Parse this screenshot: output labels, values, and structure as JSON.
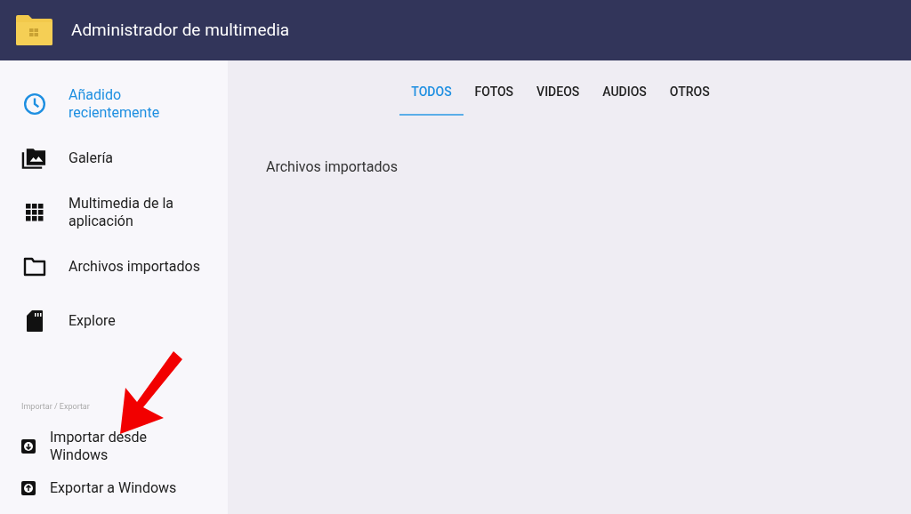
{
  "window": {
    "title": "Administrador de multimedia"
  },
  "sidebar": {
    "items": [
      {
        "label": "Añadido recientemente",
        "kind": "clock",
        "selected": true
      },
      {
        "label": "Galería",
        "kind": "gallery",
        "selected": false
      },
      {
        "label": "Multimedia de la aplicación",
        "kind": "grid",
        "selected": false
      },
      {
        "label": "Archivos importados",
        "kind": "folder",
        "selected": false
      },
      {
        "label": "Explore",
        "kind": "sdcard",
        "selected": false
      }
    ],
    "section": {
      "title": "Importar / Exportar",
      "items": [
        {
          "label": "Importar desde Windows",
          "kind": "import"
        },
        {
          "label": "Exportar a Windows",
          "kind": "export"
        }
      ]
    }
  },
  "tabs": [
    {
      "label": "TODOS",
      "selected": true
    },
    {
      "label": "FOTOS",
      "selected": false
    },
    {
      "label": "VIDEOS",
      "selected": false
    },
    {
      "label": "AUDIOS",
      "selected": false
    },
    {
      "label": "OTROS",
      "selected": false
    }
  ],
  "content": {
    "heading": "Archivos importados"
  }
}
